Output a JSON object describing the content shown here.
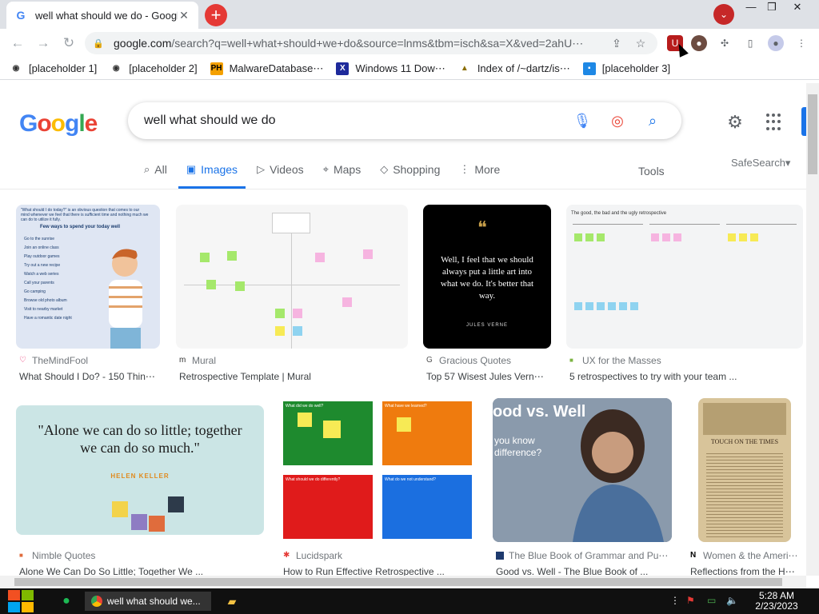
{
  "browser": {
    "tab_title": "well what should we do - Google",
    "tab_favicon": "G",
    "new_tab": "+",
    "address_host": "google.com",
    "address_rest": "/search?q=well+what+should+we+do&source=lnms&tbm=isch&sa=X&ved=2ahU⋯",
    "window_controls": [
      "—",
      "❒",
      "✕"
    ]
  },
  "bookmarks": [
    {
      "label": "[placeholder 1]",
      "icon": "site-icon"
    },
    {
      "label": "[placeholder 2]",
      "icon": "site-icon"
    },
    {
      "label": "MalwareDatabase⋯",
      "icon": "ph-icon"
    },
    {
      "label": "Windows 11 Dow⋯",
      "icon": "x-icon"
    },
    {
      "label": "Index of /~dartz/is⋯",
      "icon": "folder-icon"
    },
    {
      "label": "[placeholder 3]",
      "icon": "site-icon"
    }
  ],
  "search": {
    "query": "well what should we do"
  },
  "nav_tabs": [
    {
      "label": "All",
      "active": false
    },
    {
      "label": "Images",
      "active": true
    },
    {
      "label": "Videos",
      "active": false
    },
    {
      "label": "Maps",
      "active": false
    },
    {
      "label": "Shopping",
      "active": false
    },
    {
      "label": "More",
      "active": false
    }
  ],
  "tools_label": "Tools",
  "safesearch_label": "SafeSearch▾",
  "results": [
    {
      "source": "TheMindFool",
      "title": "What Should I Do? - 150 Thin⋯"
    },
    {
      "source": "Mural",
      "title": "Retrospective Template | Mural"
    },
    {
      "source": "Gracious Quotes",
      "title": "Top 57 Wisest Jules Vern⋯"
    },
    {
      "source": "UX for the Masses",
      "title": "5 retrospectives to try with your team ..."
    },
    {
      "source": "Nimble Quotes",
      "title": "Alone We Can Do So Little; Together We ..."
    },
    {
      "source": "Lucidspark",
      "title": "How to Run Effective Retrospective ..."
    },
    {
      "source": "The Blue Book of Grammar and Pu⋯",
      "title": "Good vs. Well - The Blue Book of ..."
    },
    {
      "source": "Women & the Ameri⋯",
      "title": "Reflections from the H⋯"
    }
  ],
  "thumb_text": {
    "mindfool_heading": "“What should I do today?” is an obvious question that comes to our mind whenever we feel that there is sufficient time and nothing much we can do to utilize it fully.",
    "mindfool_sub": "Few ways to spend your today well",
    "mindfool_items": [
      "Go to the sunrise",
      "Join an online class",
      "Play outdoor games",
      "Try out a new recipe",
      "Watch a web series",
      "Call your parents",
      "Go camping",
      "Browse old photo album",
      "Visit to nearby market",
      "Have a romantic date night"
    ],
    "verne_quote": "Well, I feel that we should always put a little art into what we do. It's better that way.",
    "verne_author": "JULES VERNE",
    "retro_title": "The good, the bad and the ugly retrospective",
    "helen_quote": "\"Alone we can do so little; together we can do so much.\"",
    "helen_author": "HELEN KELLER",
    "luc_q1": "What did we do well?",
    "luc_q2": "What have we learned?",
    "luc_q3": "What should we do differently?",
    "luc_q4": "What do we not understand?",
    "gvw_title": "ood vs. Well",
    "gvw_sub": "you know difference?",
    "old_title": "TOUCH ON THE TIMES"
  },
  "taskbar": {
    "active_app": "well what should we...",
    "time": "5:28 AM",
    "date": "2/23/2023"
  },
  "colors": {
    "accent": "#1a73e8",
    "tabstrip": "#dee1e6",
    "taskbar": "#101010"
  }
}
